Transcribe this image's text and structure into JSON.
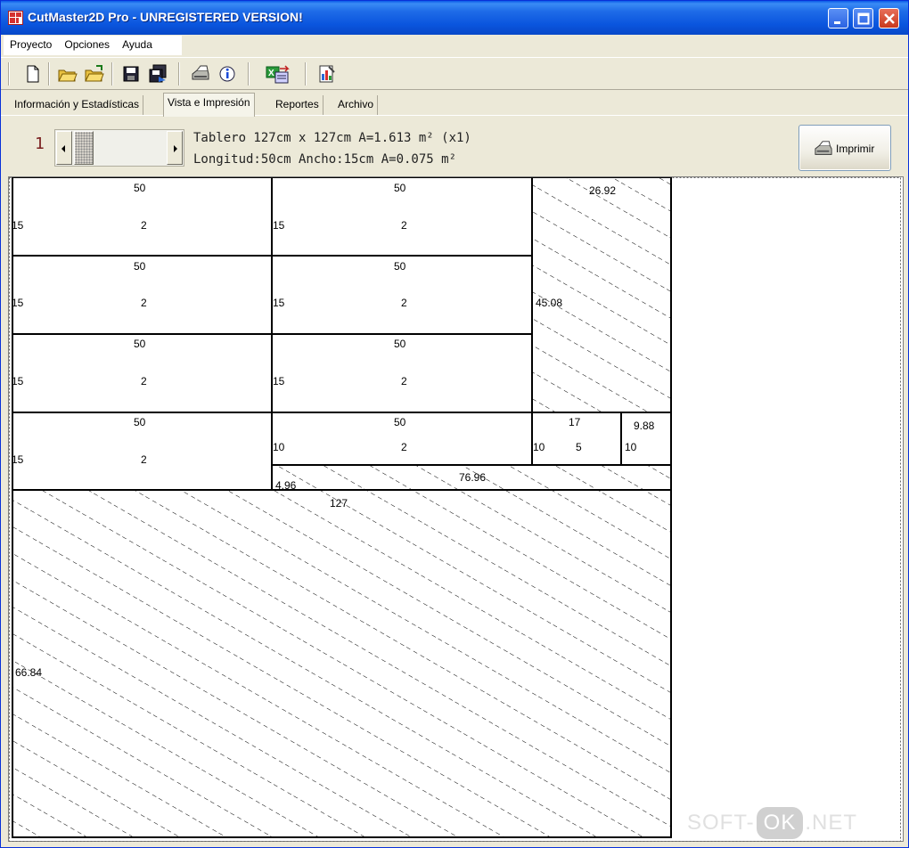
{
  "window": {
    "title": "CutMaster2D Pro - UNREGISTERED VERSION!"
  },
  "menu": [
    "Proyecto",
    "Opciones",
    "Ayuda"
  ],
  "toolbar": {
    "buttons": [
      "new-file-icon",
      "open-folder-icon",
      "open-folder-arrow-icon",
      "save-icon",
      "save-all-icon",
      "print-icon",
      "info-icon",
      "export-excel-icon",
      "report-icon"
    ]
  },
  "tabs": [
    "Información y Estadísticas",
    "Vista e Impresión",
    "Reportes",
    "Archivo"
  ],
  "active_tab": "Vista e Impresión",
  "header": {
    "page_number": "1",
    "line1": "Tablero 127cm x 127cm A=1.613 m² (x1)",
    "line2": "Longitud:50cm Ancho:15cm A=0.075 m²",
    "print_label": "Imprimir"
  },
  "layout": {
    "pieces": [
      {
        "row": 1,
        "col": 1,
        "top": "50",
        "left": "15",
        "center": "2"
      },
      {
        "row": 1,
        "col": 2,
        "top": "50",
        "left": "15",
        "center": "2"
      },
      {
        "row": 2,
        "col": 1,
        "top": "50",
        "left": "15",
        "center": "2"
      },
      {
        "row": 2,
        "col": 2,
        "top": "50",
        "left": "15",
        "center": "2"
      },
      {
        "row": 3,
        "col": 1,
        "top": "50",
        "left": "15",
        "center": "2"
      },
      {
        "row": 3,
        "col": 2,
        "top": "50",
        "left": "15",
        "center": "2"
      },
      {
        "row": 4,
        "col": 1,
        "top": "50",
        "left": "15",
        "center": "2"
      },
      {
        "row": 4,
        "col": 2,
        "top": "50",
        "left": "10",
        "center": "2"
      },
      {
        "row": 4,
        "col": 3,
        "top": "17",
        "left": "10",
        "center": "5"
      },
      {
        "row": 4,
        "col": 4,
        "top": "9.88",
        "left": "10",
        "center": ""
      }
    ],
    "waste": [
      {
        "name": "waste-right-top",
        "top": "26.92",
        "left": "45.08"
      },
      {
        "name": "waste-strip",
        "top": "76.96",
        "left": "4.96"
      },
      {
        "name": "waste-bottom",
        "top": "127",
        "left": "66.84"
      }
    ]
  },
  "watermark": {
    "left": "SOFT-",
    "middle": "OK",
    "right": ".NET"
  }
}
